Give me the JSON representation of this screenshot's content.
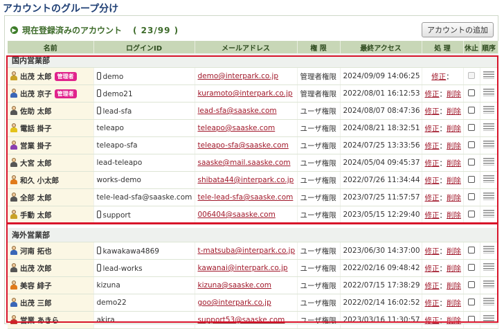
{
  "page_title": "アカウントのグループ分け",
  "section_title": "現在登録済みのアカウント",
  "count_text": "( 23/99 )",
  "add_button_label": "アカウントの追加",
  "columns": {
    "name": "名前",
    "login": "ログインID",
    "email": "メールアドレス",
    "role": "権 限",
    "last": "最終アクセス",
    "ops": "処 理",
    "suspend": "休止",
    "order": "順序"
  },
  "ops": {
    "edit": "修正",
    "delete": "削除",
    "sep": "："
  },
  "colors": {
    "accent": "#3d6b2a",
    "header_bg": "#c8d7b7",
    "link": "#a1182a",
    "badge": "#e0238c",
    "highlight": "#d8142a"
  },
  "groups": [
    {
      "name": "国内営業部",
      "rows": [
        {
          "name": "出茂 太郎",
          "badge": "管理者",
          "login": "demo",
          "mobile": true,
          "email": "demo@interpark.co.jp",
          "role": "管理者権限",
          "last": "2024/09/09 14:06:25",
          "can_delete": false,
          "icon_color": "#c9a227"
        },
        {
          "name": "出茂 京子",
          "badge": "管理者",
          "login": "demo21",
          "mobile": true,
          "email": "kuramoto@interpark.co.jp",
          "role": "管理者権限",
          "last": "2022/08/01 16:12:53",
          "can_delete": true,
          "icon_color": "#3a66b7"
        },
        {
          "name": "佐助 太郎",
          "login": "lead-sfa",
          "mobile": true,
          "email": "lead-sfa@saaske.com",
          "role": "ユーザ権限",
          "last": "2024/08/07 08:47:36",
          "can_delete": true,
          "icon_color": "#555555"
        },
        {
          "name": "電話 掛子",
          "login": "teleapo",
          "mobile": false,
          "email": "teleapo@saaske.com",
          "role": "ユーザ権限",
          "last": "2024/08/21 18:32:51",
          "can_delete": true,
          "icon_color": "#e3c21a"
        },
        {
          "name": "営業 掛子",
          "login": "teleapo-sfa",
          "mobile": false,
          "email": "teleapo-sfa@saaske.com",
          "role": "ユーザ権限",
          "last": "2024/07/25 13:33:56",
          "can_delete": true,
          "icon_color": "#8a3fb0"
        },
        {
          "name": "大宮 太郎",
          "login": "lead-teleapo",
          "mobile": false,
          "email": "saaske@mail.saaske.com",
          "role": "ユーザ権限",
          "last": "2024/05/04 09:45:37",
          "can_delete": true,
          "icon_color": "#555555"
        },
        {
          "name": "和久 小太郎",
          "login": "works-demo",
          "mobile": false,
          "email": "shibata44@interpark.co.jp",
          "role": "ユーザ権限",
          "last": "2022/07/26 11:34:44",
          "can_delete": true,
          "icon_color": "#e07a1a"
        },
        {
          "name": "全部 太郎",
          "login": "tele-lead-sfa@saaske.com",
          "mobile": false,
          "email": "tele-lead-sfa@saaske.com",
          "role": "ユーザ権限",
          "last": "2023/07/25 11:57:57",
          "can_delete": true,
          "icon_color": "#555555"
        },
        {
          "name": "手動 太郎",
          "login": "support",
          "mobile": true,
          "email": "006404@saaske.com",
          "role": "ユーザ権限",
          "last": "2023/05/15 12:29:40",
          "can_delete": true,
          "icon_color": "#c9a227"
        }
      ]
    },
    {
      "name": "海外営業部",
      "rows": [
        {
          "name": "河南 拓也",
          "login": "kawakawa4869",
          "mobile": true,
          "email": "t-matsuba@interpark.co.jp",
          "role": "ユーザ権限",
          "last": "2023/06/30 14:37:00",
          "can_delete": true,
          "icon_color": "#3a66b7"
        },
        {
          "name": "出茂 次郎",
          "login": "lead-works",
          "mobile": true,
          "email": "kawanai@interpark.co.jp",
          "role": "ユーザ権限",
          "last": "2022/02/16 09:48:42",
          "can_delete": true,
          "icon_color": "#555555"
        },
        {
          "name": "美容 緋子",
          "login": "kizuna",
          "mobile": false,
          "email": "kizuna@saaske.com",
          "role": "ユーザ権限",
          "last": "2022/07/15 17:38:29",
          "can_delete": true,
          "icon_color": "#e07a1a"
        },
        {
          "name": "出茂 三郎",
          "login": "demo22",
          "mobile": false,
          "email": "goo@interpark.co.jp",
          "role": "ユーザ権限",
          "last": "2022/02/14 16:02:52",
          "can_delete": true,
          "icon_color": "#3a66b7"
        },
        {
          "name": "営業 あきら",
          "login": "akira",
          "mobile": false,
          "email": "support53@saaske.com",
          "role": "ユーザ権限",
          "last": "2023/03/16 11:30:57",
          "can_delete": true,
          "icon_color": "#c0392b"
        }
      ]
    }
  ]
}
